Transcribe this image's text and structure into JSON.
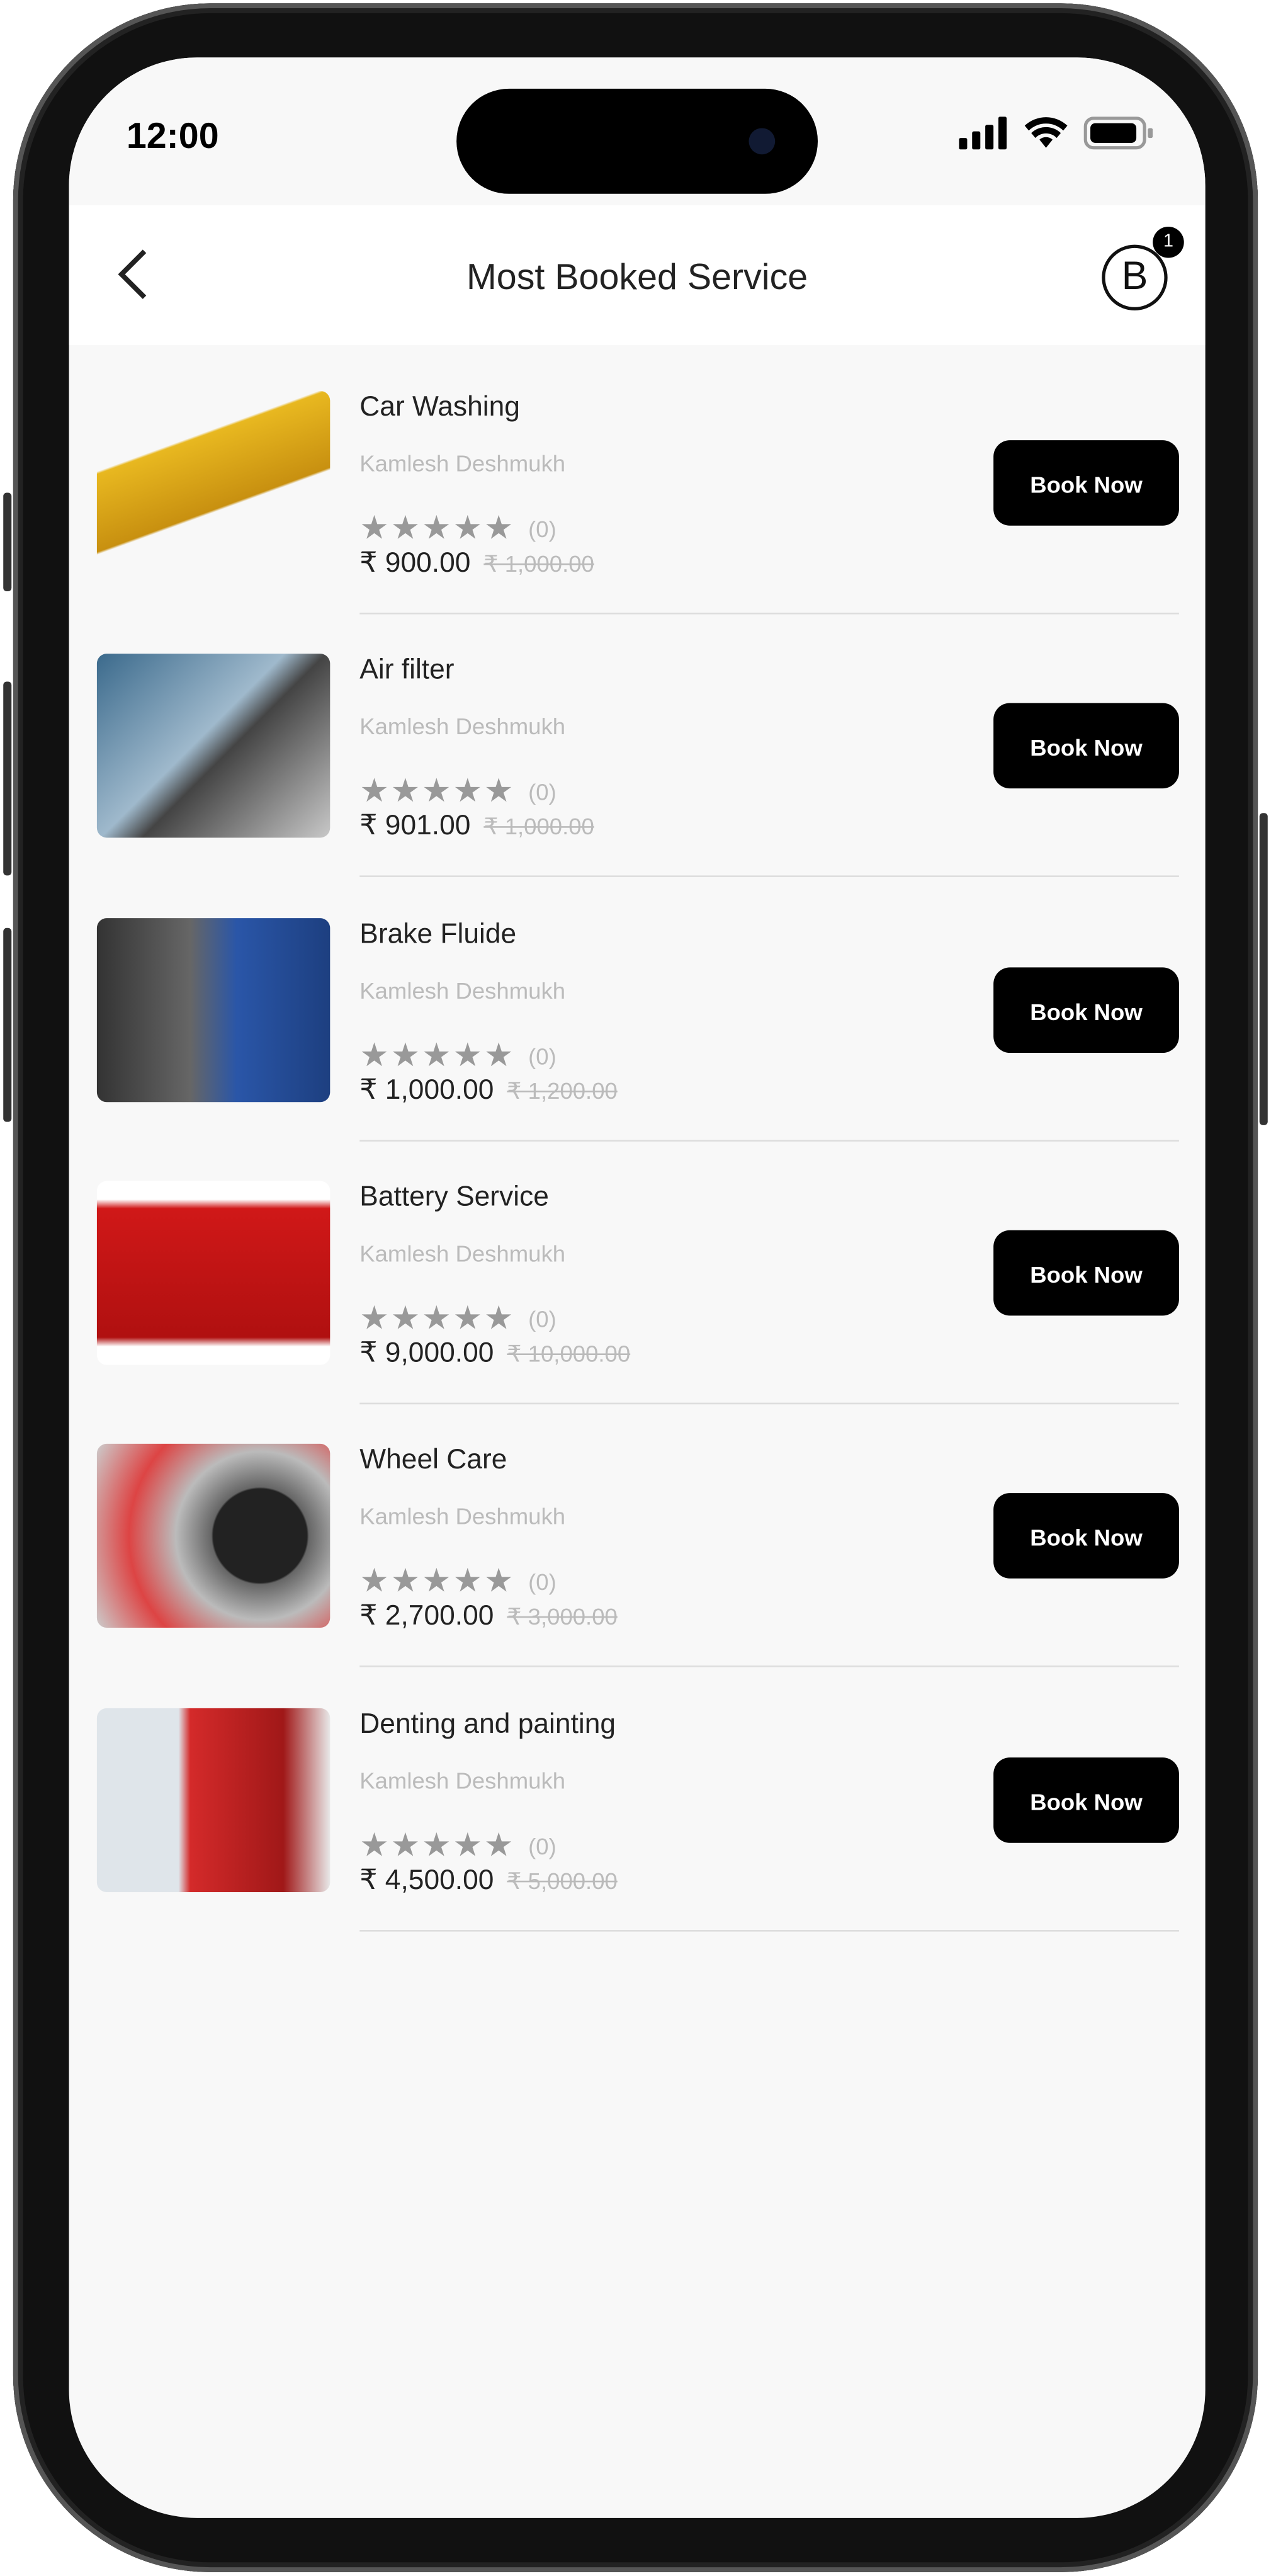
{
  "status_bar": {
    "time": "12:00"
  },
  "header": {
    "title": "Most Booked Service",
    "cart_letter": "B",
    "cart_badge": "1"
  },
  "services": [
    {
      "name": "Car Washing",
      "provider": "Kamlesh Deshmukh",
      "rating_count": "(0)",
      "price": "₹ 900.00",
      "original_price": "₹ 1,000.00",
      "button": "Book Now",
      "image": "car-washing"
    },
    {
      "name": "Air filter",
      "provider": "Kamlesh Deshmukh",
      "rating_count": "(0)",
      "price": "₹ 901.00",
      "original_price": "₹ 1,000.00",
      "button": "Book Now",
      "image": "air-filter"
    },
    {
      "name": "Brake Fluide",
      "provider": "Kamlesh Deshmukh",
      "rating_count": "(0)",
      "price": "₹ 1,000.00",
      "original_price": "₹ 1,200.00",
      "button": "Book Now",
      "image": "brake"
    },
    {
      "name": "Battery Service",
      "provider": "Kamlesh Deshmukh",
      "rating_count": "(0)",
      "price": "₹ 9,000.00",
      "original_price": "₹ 10,000.00",
      "button": "Book Now",
      "image": "battery"
    },
    {
      "name": "Wheel Care",
      "provider": "Kamlesh Deshmukh",
      "rating_count": "(0)",
      "price": "₹ 2,700.00",
      "original_price": "₹ 3,000.00",
      "button": "Book Now",
      "image": "wheel"
    },
    {
      "name": "Denting and painting",
      "provider": "Kamlesh Deshmukh",
      "rating_count": "(0)",
      "price": "₹ 4,500.00",
      "original_price": "₹ 5,000.00",
      "button": "Book Now",
      "image": "painting"
    }
  ],
  "colors": {
    "button_bg": "#000000",
    "background": "#f8f8f8",
    "star": "#999999"
  }
}
